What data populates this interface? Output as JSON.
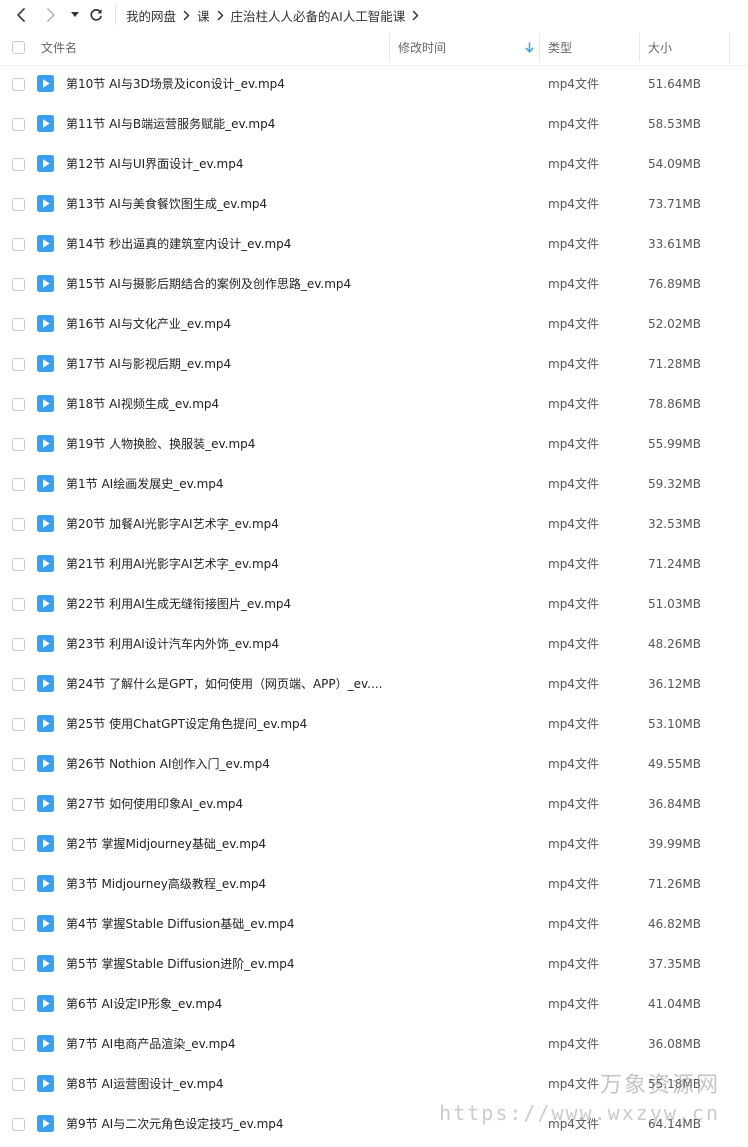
{
  "breadcrumb": [
    "我的网盘",
    "课",
    "庄治柱人人必备的AI人工智能课"
  ],
  "columns": {
    "name": "文件名",
    "mtime": "修改时间",
    "type": "类型",
    "size": "大小"
  },
  "icons": {
    "back": "chevron-left-icon",
    "forward": "chevron-right-icon",
    "history": "caret-down-icon",
    "refresh": "refresh-icon",
    "file": "video-play-icon",
    "sort": "arrow-down-icon"
  },
  "colors": {
    "file_icon": "#3a9ff0",
    "sort_arrow": "#3a9ff0"
  },
  "files": [
    {
      "name": "第10节 AI与3D场景及icon设计_ev.mp4",
      "type": "mp4文件",
      "size": "51.64MB"
    },
    {
      "name": "第11节 AI与B端运营服务赋能_ev.mp4",
      "type": "mp4文件",
      "size": "58.53MB"
    },
    {
      "name": "第12节 AI与UI界面设计_ev.mp4",
      "type": "mp4文件",
      "size": "54.09MB"
    },
    {
      "name": "第13节 AI与美食餐饮图生成_ev.mp4",
      "type": "mp4文件",
      "size": "73.71MB"
    },
    {
      "name": "第14节 秒出逼真的建筑室内设计_ev.mp4",
      "type": "mp4文件",
      "size": "33.61MB"
    },
    {
      "name": "第15节 AI与摄影后期结合的案例及创作思路_ev.mp4",
      "type": "mp4文件",
      "size": "76.89MB"
    },
    {
      "name": "第16节 AI与文化产业_ev.mp4",
      "type": "mp4文件",
      "size": "52.02MB"
    },
    {
      "name": "第17节 AI与影视后期_ev.mp4",
      "type": "mp4文件",
      "size": "71.28MB"
    },
    {
      "name": "第18节 AI视频生成_ev.mp4",
      "type": "mp4文件",
      "size": "78.86MB"
    },
    {
      "name": "第19节 人物换脸、换服装_ev.mp4",
      "type": "mp4文件",
      "size": "55.99MB"
    },
    {
      "name": "第1节 AI绘画发展史_ev.mp4",
      "type": "mp4文件",
      "size": "59.32MB"
    },
    {
      "name": "第20节 加餐AI光影字AI艺术字_ev.mp4",
      "type": "mp4文件",
      "size": "32.53MB"
    },
    {
      "name": "第21节 利用AI光影字AI艺术字_ev.mp4",
      "type": "mp4文件",
      "size": "71.24MB"
    },
    {
      "name": "第22节 利用AI生成无缝衔接图片_ev.mp4",
      "type": "mp4文件",
      "size": "51.03MB"
    },
    {
      "name": "第23节 利用AI设计汽车内外饰_ev.mp4",
      "type": "mp4文件",
      "size": "48.26MB"
    },
    {
      "name": "第24节 了解什么是GPT，如何使用（网页端、APP）_ev....",
      "type": "mp4文件",
      "size": "36.12MB"
    },
    {
      "name": "第25节 使用ChatGPT设定角色提问_ev.mp4",
      "type": "mp4文件",
      "size": "53.10MB"
    },
    {
      "name": "第26节 Nothion AI创作入门_ev.mp4",
      "type": "mp4文件",
      "size": "49.55MB"
    },
    {
      "name": "第27节 如何使用印象AI_ev.mp4",
      "type": "mp4文件",
      "size": "36.84MB"
    },
    {
      "name": "第2节 掌握Midjourney基础_ev.mp4",
      "type": "mp4文件",
      "size": "39.99MB"
    },
    {
      "name": "第3节 Midjourney高级教程_ev.mp4",
      "type": "mp4文件",
      "size": "71.26MB"
    },
    {
      "name": "第4节 掌握Stable Diffusion基础_ev.mp4",
      "type": "mp4文件",
      "size": "46.82MB"
    },
    {
      "name": "第5节 掌握Stable Diffusion进阶_ev.mp4",
      "type": "mp4文件",
      "size": "37.35MB"
    },
    {
      "name": "第6节 AI设定IP形象_ev.mp4",
      "type": "mp4文件",
      "size": "41.04MB"
    },
    {
      "name": "第7节 AI电商产品渲染_ev.mp4",
      "type": "mp4文件",
      "size": "36.08MB"
    },
    {
      "name": "第8节 AI运营图设计_ev.mp4",
      "type": "mp4文件",
      "size": "55.18MB"
    },
    {
      "name": "第9节 AI与二次元角色设定技巧_ev.mp4",
      "type": "mp4文件",
      "size": "64.14MB"
    }
  ],
  "watermark": {
    "title": "万象资源网",
    "url": "https://www.wxzyw.cn"
  }
}
